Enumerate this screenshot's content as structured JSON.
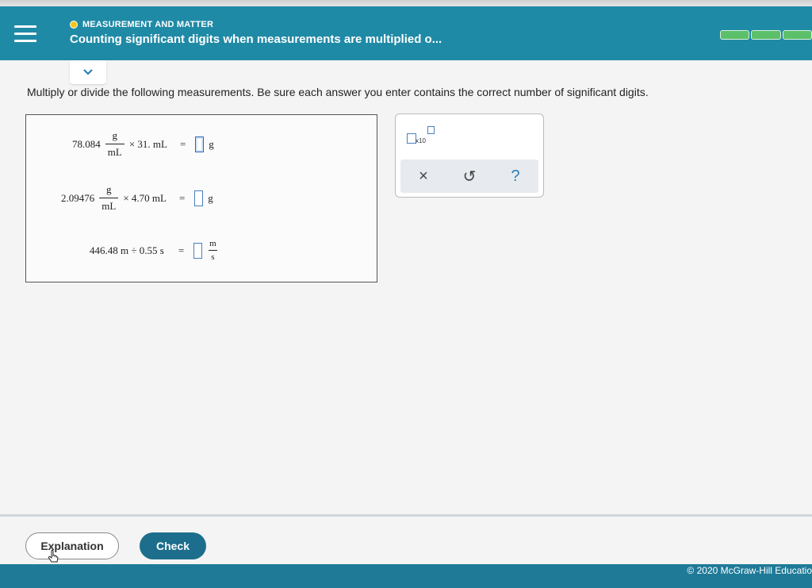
{
  "header": {
    "topic": "MEASUREMENT AND MATTER",
    "title": "Counting significant digits when measurements are multiplied o..."
  },
  "instructions": "Multiply or divide the following measurements. Be sure each answer you enter contains the correct number of significant digits.",
  "problems": [
    {
      "lead": "78.084",
      "num": "g",
      "den": "mL",
      "op": "× 31. mL",
      "eq": "=",
      "unit": "g"
    },
    {
      "lead": "2.09476",
      "num": "g",
      "den": "mL",
      "op": "× 4.70 mL",
      "eq": "=",
      "unit": "g"
    },
    {
      "lead": "446.48 m ÷ 0.55 s",
      "eq": "=",
      "unit_num": "m",
      "unit_den": "s"
    }
  ],
  "palette": {
    "sci_label": "x10",
    "clear_symbol": "×",
    "undo_symbol": "↺",
    "help_symbol": "?"
  },
  "buttons": {
    "explanation": "Explanation",
    "check": "Check"
  },
  "footer": {
    "copyright": "© 2020 McGraw-Hill Educatio"
  },
  "colors": {
    "header": "#1f8aa6",
    "progress": "#5cc06a",
    "check_button": "#1c6e8c"
  }
}
